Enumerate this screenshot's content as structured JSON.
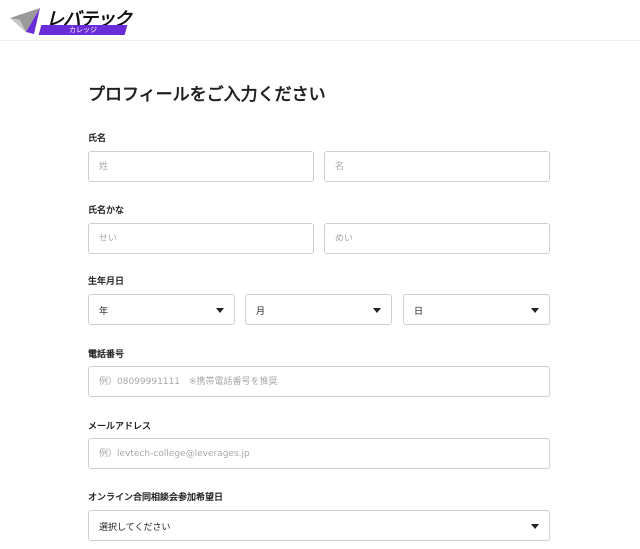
{
  "brand": {
    "name": "レバテック",
    "sub": "カレッジ",
    "colors": {
      "accent": "#6a2bd9",
      "accent_light": "#8b5cf6",
      "mark_gray": "#9a9a9a"
    }
  },
  "form": {
    "title": "プロフィールをご入力ください",
    "name": {
      "label": "氏名",
      "last_placeholder": "姓",
      "first_placeholder": "名"
    },
    "kana": {
      "label": "氏名かな",
      "last_placeholder": "せい",
      "first_placeholder": "めい"
    },
    "birthday": {
      "label": "生年月日",
      "year": "年",
      "month": "月",
      "day": "日"
    },
    "phone": {
      "label": "電話番号",
      "placeholder": "例）08099991111　※携帯電話番号を推奨"
    },
    "email": {
      "label": "メールアドレス",
      "placeholder": "例）levtech-college@leverages.jp"
    },
    "consultation": {
      "label": "オンライン合同相談会参加希望日",
      "selected": "選択してください"
    }
  }
}
